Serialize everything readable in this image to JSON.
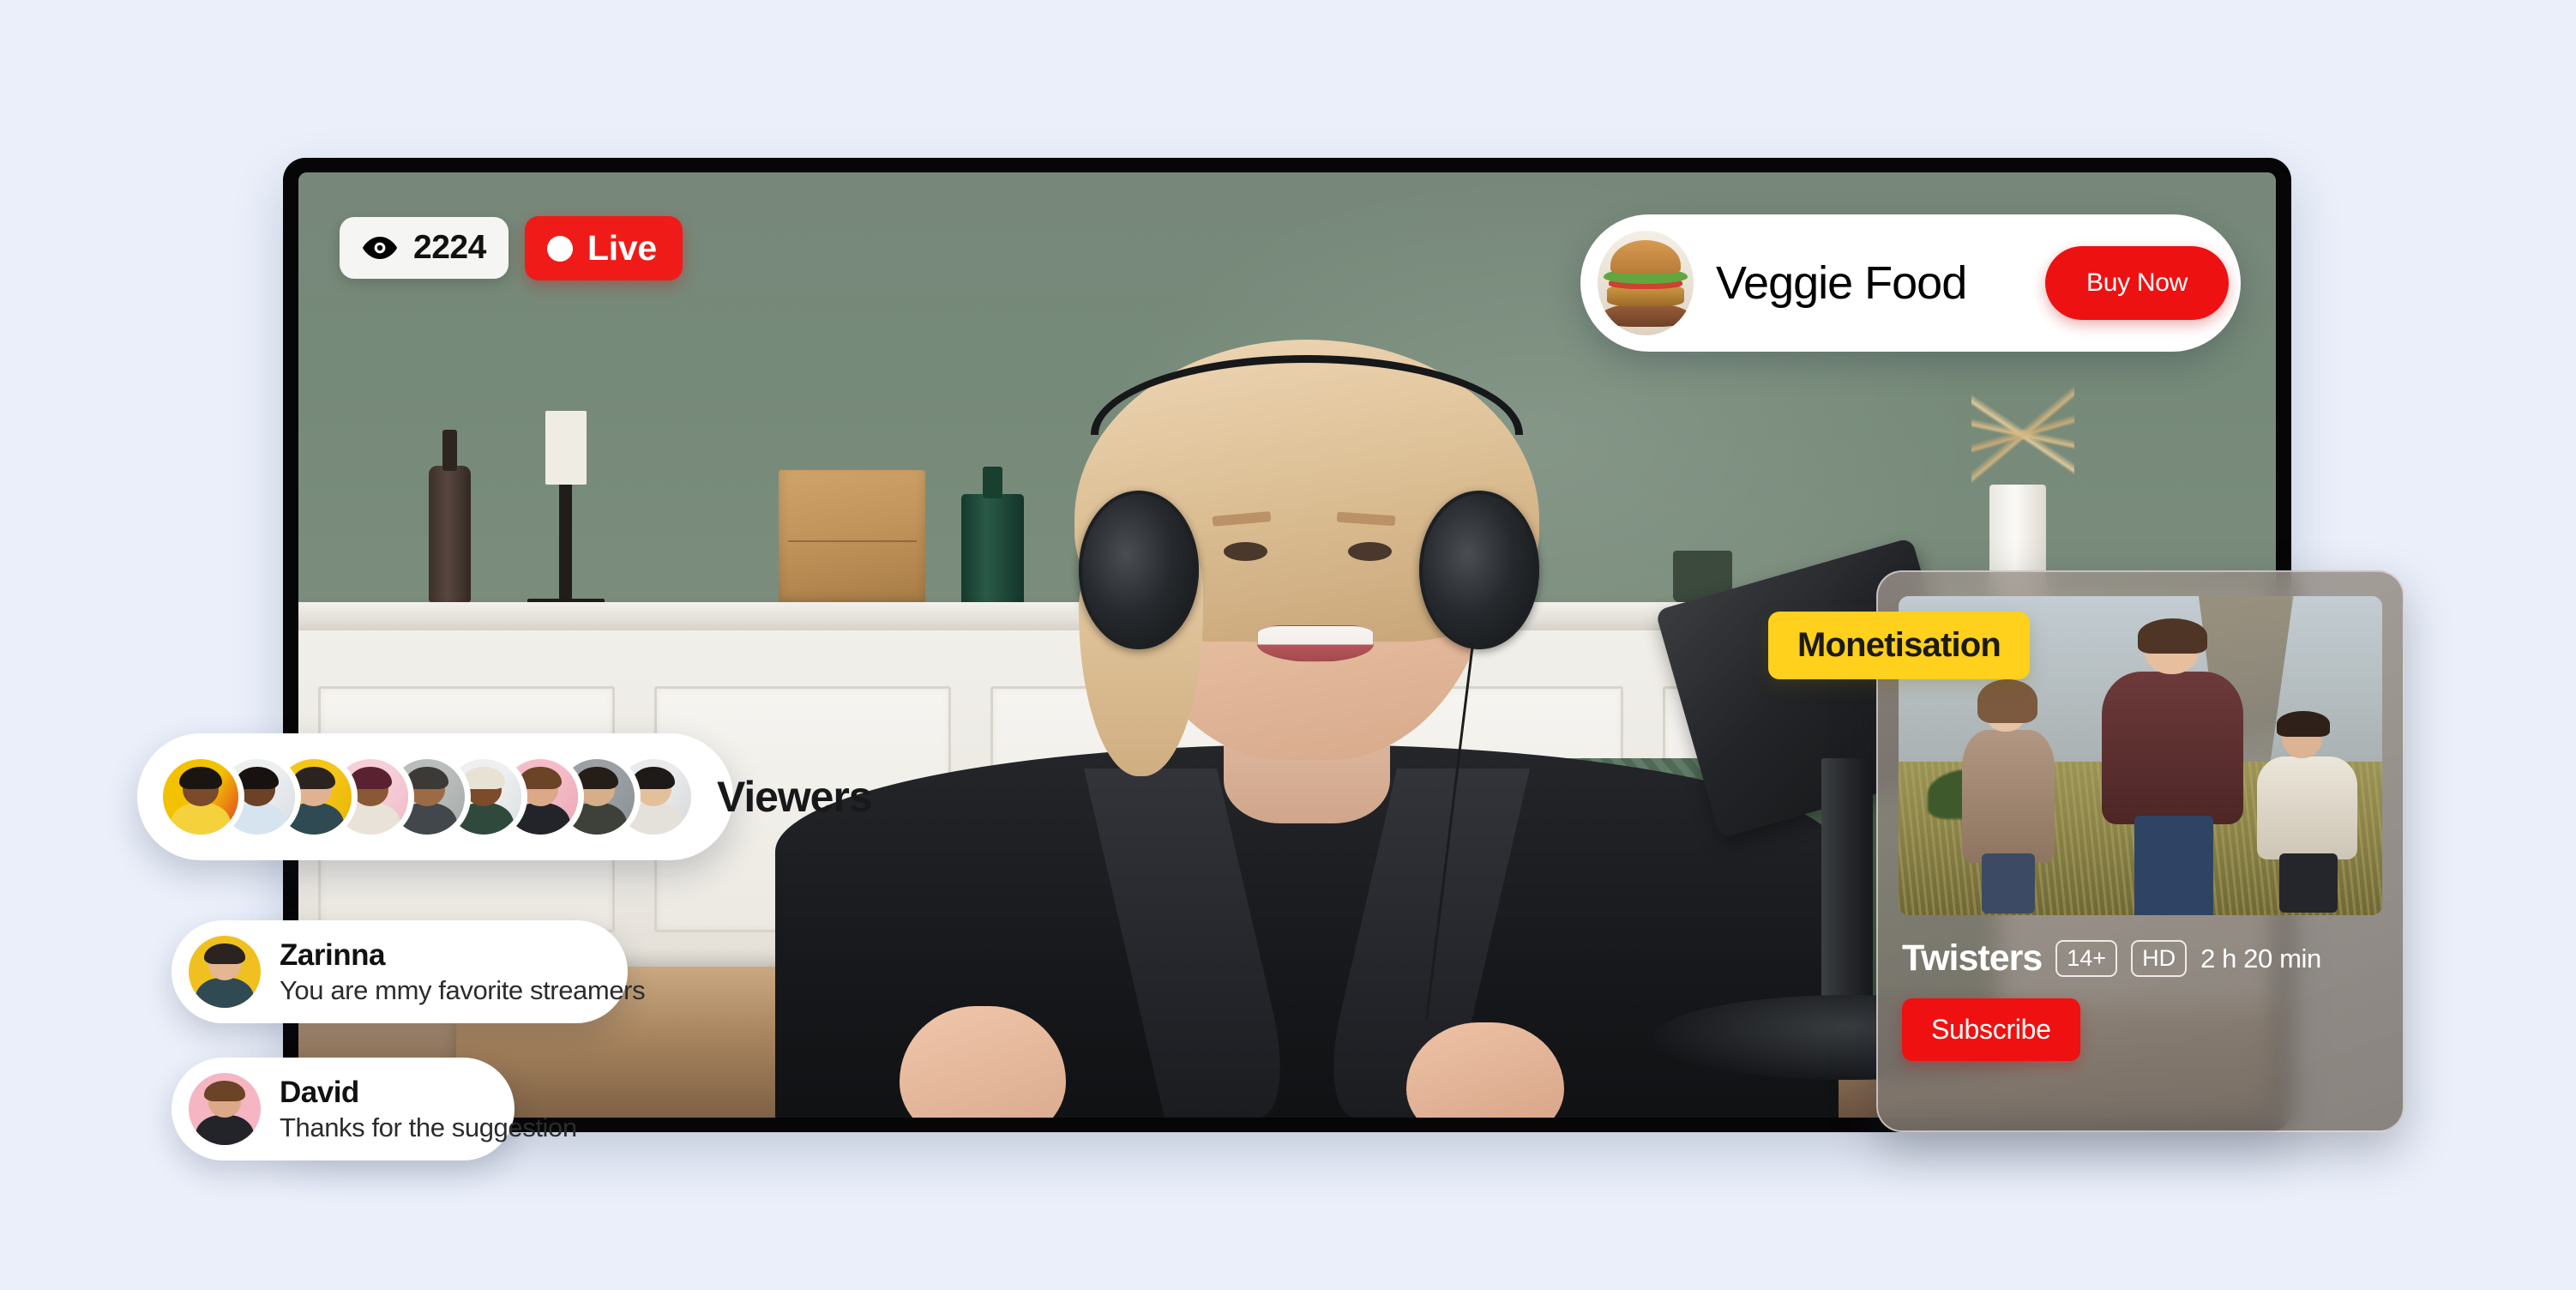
{
  "theme": {
    "page_background": "#eaeffa",
    "accent_red": "#ef1b19",
    "accent_yellow": "#ffd01c",
    "card_white": "#ffffff"
  },
  "stream": {
    "viewer_count": "2224",
    "viewer_icon": "eye-icon",
    "live_label": "Live",
    "live_indicator": "live-dot"
  },
  "promo": {
    "product_name": "Veggie Food",
    "cta_label": "Buy Now",
    "thumbnail_icon": "burger-thumbnail"
  },
  "viewers": {
    "label": "Viewers",
    "avatars": [
      {
        "name": "viewer-avatar-1",
        "bg": "#f2c200",
        "accent": "#e03a28",
        "skin": "#7a4a2c",
        "hair": "#1b1512",
        "body": "#f5d23c"
      },
      {
        "name": "viewer-avatar-2",
        "bg": "#eceef0",
        "accent": "#d8dde2",
        "skin": "#6b4226",
        "hair": "#17120f",
        "body": "#d6e4f0"
      },
      {
        "name": "viewer-avatar-3",
        "bg": "#f5c518",
        "accent": "#e8b400",
        "skin": "#e0b291",
        "hair": "#2b2320",
        "body": "#2f4a52"
      },
      {
        "name": "viewer-avatar-4",
        "bg": "#f6cfd8",
        "accent": "#efb9c6",
        "skin": "#8a5834",
        "hair": "#5a2230",
        "body": "#e8e2d8"
      },
      {
        "name": "viewer-avatar-5",
        "bg": "#b9bdbb",
        "accent": "#a6aaa8",
        "skin": "#9c6b45",
        "hair": "#3c3a37",
        "body": "#41474a"
      },
      {
        "name": "viewer-avatar-6",
        "bg": "#edeff0",
        "accent": "#dcdfe0",
        "skin": "#7c4b2a",
        "hair": "#e8e2d4",
        "body": "#2f4a3c"
      },
      {
        "name": "viewer-avatar-7",
        "bg": "#f4bcc8",
        "accent": "#eca7b6",
        "skin": "#dba988",
        "hair": "#6b4327",
        "body": "#23242a"
      },
      {
        "name": "viewer-avatar-8",
        "bg": "#9aa0a4",
        "accent": "#8a9094",
        "skin": "#d7ae8a",
        "hair": "#241d18",
        "body": "#3e4139"
      },
      {
        "name": "viewer-avatar-9",
        "bg": "#e9eaec",
        "accent": "#d5d7da",
        "skin": "#e3c09c",
        "hair": "#1d1a17",
        "body": "#e4e1da"
      }
    ]
  },
  "chat": [
    {
      "name": "Zarinna",
      "message": "You are mmy favorite streamers",
      "avatar_bg": "#f0c021",
      "avatar_skin": "#e3b791",
      "avatar_hair": "#2a2320",
      "avatar_body": "#2f4a52"
    },
    {
      "name": "David",
      "message": "Thanks for the suggestion",
      "avatar_bg": "#f6b5c2",
      "avatar_skin": "#dba988",
      "avatar_hair": "#6b4327",
      "avatar_body": "#23242a"
    }
  ],
  "monetisation": {
    "badge_label": "Monetisation"
  },
  "movie": {
    "title": "Twisters",
    "rating_badge": "14+",
    "quality_badge": "HD",
    "duration": "2 h 20 min",
    "subscribe_label": "Subscribe",
    "poster_alt": "twisters-poster"
  }
}
